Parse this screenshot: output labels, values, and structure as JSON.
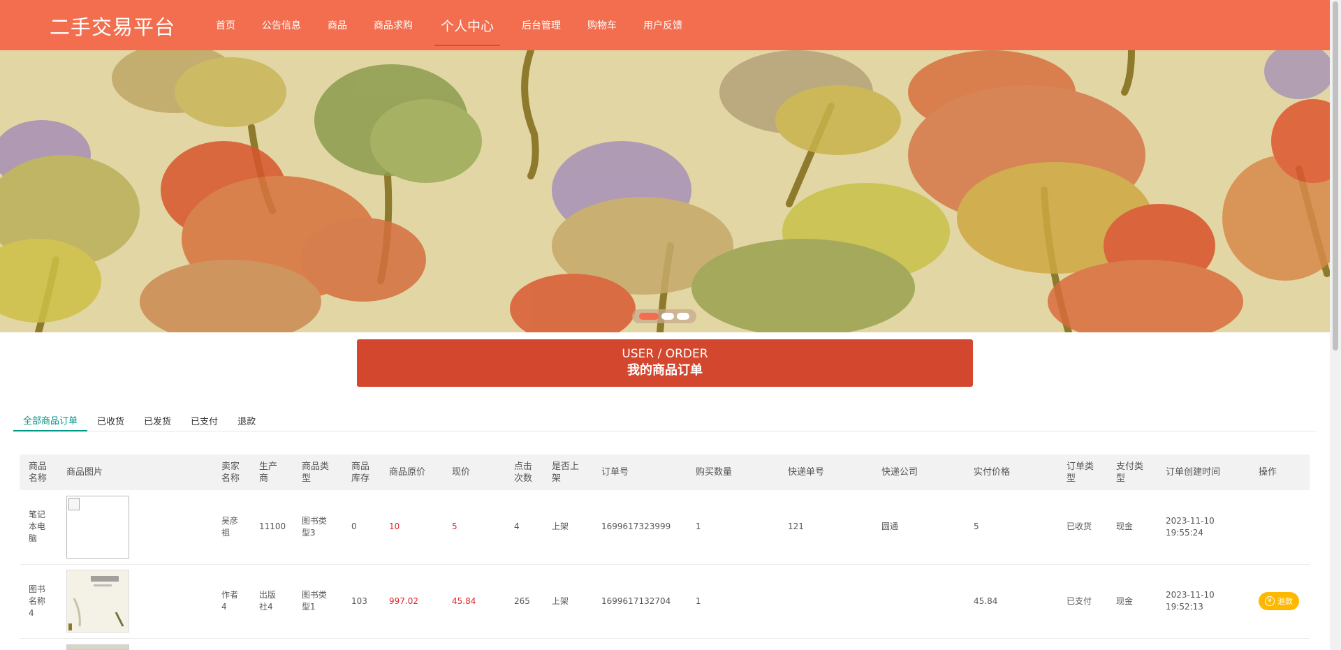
{
  "header": {
    "brand": "二手交易平台",
    "nav": [
      {
        "label": "首页",
        "active": false
      },
      {
        "label": "公告信息",
        "active": false
      },
      {
        "label": "商品",
        "active": false
      },
      {
        "label": "商品求购",
        "active": false
      },
      {
        "label": "个人中心",
        "active": true
      },
      {
        "label": "后台管理",
        "active": false
      },
      {
        "label": "购物车",
        "active": false
      },
      {
        "label": "用户反馈",
        "active": false
      }
    ]
  },
  "banner": {
    "slide_count": 3,
    "active_slide": 1
  },
  "section": {
    "title_en": "USER / ORDER",
    "title_cn": "我的商品订单"
  },
  "tabs": [
    {
      "label": "全部商品订单",
      "active": true
    },
    {
      "label": "已收货",
      "active": false
    },
    {
      "label": "已发货",
      "active": false
    },
    {
      "label": "已支付",
      "active": false
    },
    {
      "label": "退款",
      "active": false
    }
  ],
  "table": {
    "columns": [
      "商品名称",
      "商品图片",
      "卖家名称",
      "生产商",
      "商品类型",
      "商品库存",
      "商品原价",
      "现价",
      "点击次数",
      "是否上架",
      "订单号",
      "购买数量",
      "快递单号",
      "快递公司",
      "实付价格",
      "订单类型",
      "支付类型",
      "订单创建时间",
      "操作"
    ],
    "rows": [
      {
        "name": "笔记本电脑",
        "image": "broken",
        "seller": "吴彦祖",
        "maker": "11100",
        "type": "图书类型3",
        "stock": "0",
        "orig_price": "10",
        "price": "5",
        "clicks": "4",
        "on_shelf": "上架",
        "order_no": "1699617323999",
        "qty": "1",
        "tracking_no": "121",
        "courier": "圆通",
        "paid": "5",
        "order_type": "已收货",
        "pay_type": "现金",
        "created": "2023-11-10 19:55:24",
        "action": ""
      },
      {
        "name": "图书名称4",
        "image": "book",
        "seller": "作者4",
        "maker": "出版社4",
        "type": "图书类型1",
        "stock": "103",
        "orig_price": "997.02",
        "price": "45.84",
        "clicks": "265",
        "on_shelf": "上架",
        "order_no": "1699617132704",
        "qty": "1",
        "tracking_no": "",
        "courier": "",
        "paid": "45.84",
        "order_type": "已支付",
        "pay_type": "现金",
        "created": "2023-11-10 19:52:13",
        "action": "退款"
      }
    ]
  },
  "colors": {
    "header": "#f26e4e",
    "section_title": "#d3472e",
    "tab_active": "#009688",
    "price_red": "#e0252b",
    "refund_button": "#ffb800"
  }
}
